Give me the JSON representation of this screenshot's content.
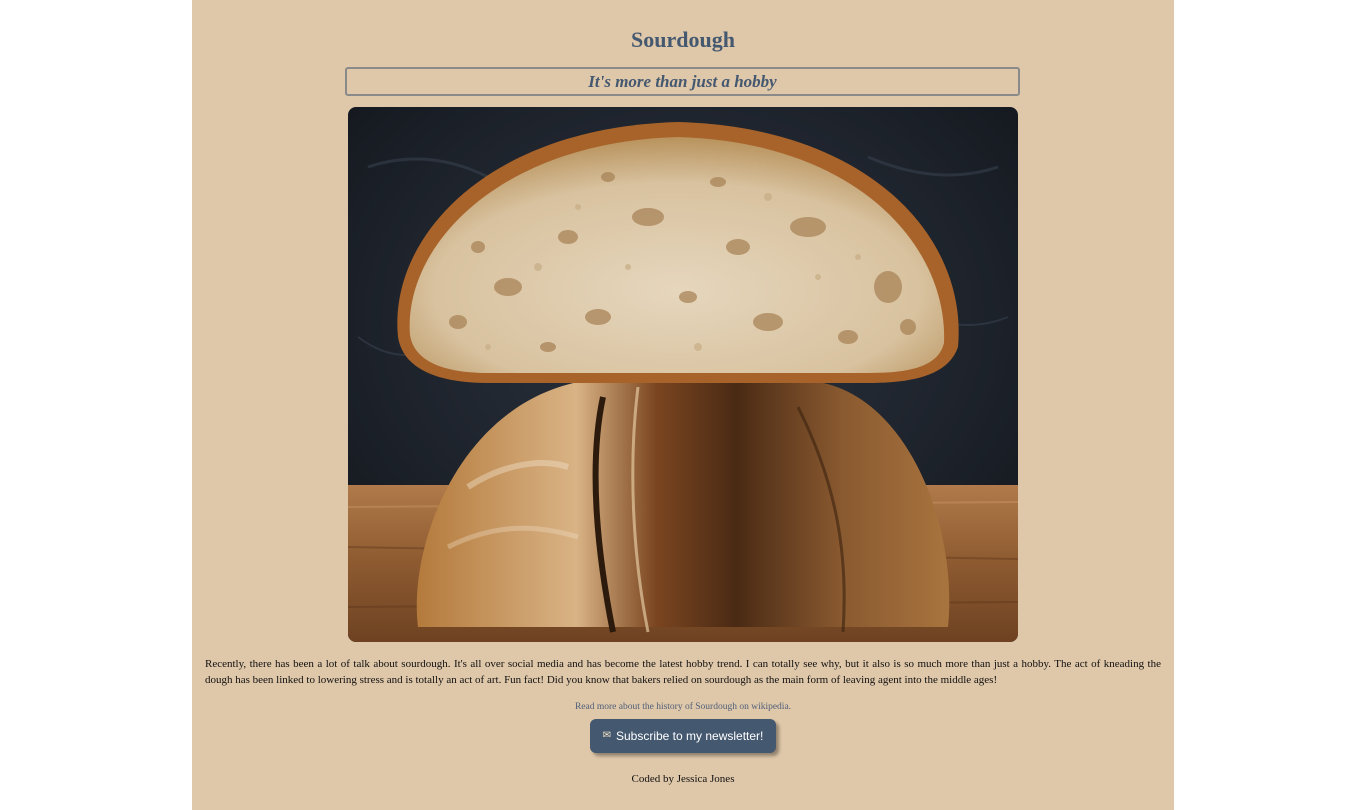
{
  "page": {
    "title": "Sourdough",
    "tagline": "It's more than just a hobby",
    "image_alt": "Sourdough loaf cut in half",
    "body": "Recently, there has been a lot of talk about sourdough. It's all over social media and has become the latest hobby trend. I can totally see why, but it also is so much more than just a hobby. The act of kneading the dough has been linked to lowering stress and is totally an act of art. Fun fact! Did you know that bakers relied on sourdough as the main form of leaving agent into the middle ages!",
    "wiki_link": "Read more about the history of Sourdough on wikipedia.",
    "subscribe_label": "Subscribe to my newsletter!",
    "subscribe_icon": "envelope-icon",
    "footer": "Coded by Jessica Jones"
  },
  "colors": {
    "page_background": "#dfc7a9",
    "heading": "#445870",
    "button": "#445870",
    "outer_background": "#ffffff"
  }
}
